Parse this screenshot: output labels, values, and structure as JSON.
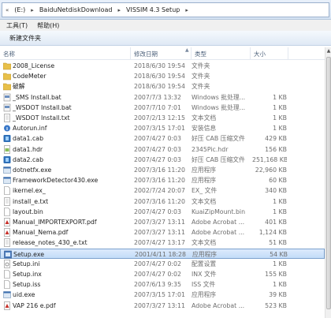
{
  "address": {
    "crumbs": [
      "(E:)",
      "BaiduNetdiskDownload",
      "VISSIM 4.3 Setup"
    ]
  },
  "menu": {
    "items": [
      "工具(T)",
      "帮助(H)"
    ]
  },
  "toolbar": {
    "new_folder": "新建文件夹"
  },
  "columns": {
    "name": "名称",
    "date": "修改日期",
    "type": "类型",
    "size": "大小"
  },
  "files": [
    {
      "name": "2008_License",
      "date": "2018/6/30 19:54",
      "type": "文件夹",
      "size": "",
      "icon": "folder-icon"
    },
    {
      "name": "CodeMeter",
      "date": "2018/6/30 19:54",
      "type": "文件夹",
      "size": "",
      "icon": "folder-icon"
    },
    {
      "name": "破解",
      "date": "2018/6/30 19:54",
      "type": "文件夹",
      "size": "",
      "icon": "folder-icon"
    },
    {
      "name": "_SMS Install.bat",
      "date": "2007/7/3 13:32",
      "type": "Windows 批处理...",
      "size": "1 KB",
      "icon": "bat-icon"
    },
    {
      "name": "_WSDOT Install.bat",
      "date": "2007/7/10 7:01",
      "type": "Windows 批处理...",
      "size": "1 KB",
      "icon": "bat-icon"
    },
    {
      "name": "_WSDOT Install.txt",
      "date": "2007/2/13 12:15",
      "type": "文本文档",
      "size": "1 KB",
      "icon": "txt-icon"
    },
    {
      "name": "Autorun.inf",
      "date": "2007/3/15 17:01",
      "type": "安装信息",
      "size": "1 KB",
      "icon": "inf-icon"
    },
    {
      "name": "data1.cab",
      "date": "2007/4/27 0:03",
      "type": "好压 CAB 压缩文件",
      "size": "429 KB",
      "icon": "cab-icon"
    },
    {
      "name": "data1.hdr",
      "date": "2007/4/27 0:03",
      "type": "2345Pic.hdr",
      "size": "156 KB",
      "icon": "hdr-icon"
    },
    {
      "name": "data2.cab",
      "date": "2007/4/27 0:03",
      "type": "好压 CAB 压缩文件",
      "size": "251,168 KB",
      "icon": "cab-icon"
    },
    {
      "name": "dotnetfx.exe",
      "date": "2007/3/16 11:20",
      "type": "应用程序",
      "size": "22,960 KB",
      "icon": "exe-icon"
    },
    {
      "name": "FrameworkDetector430.exe",
      "date": "2007/3/16 11:20",
      "type": "应用程序",
      "size": "60 KB",
      "icon": "exe-icon"
    },
    {
      "name": "ikernel.ex_",
      "date": "2002/7/24 20:07",
      "type": "EX_ 文件",
      "size": "340 KB",
      "icon": "file-icon"
    },
    {
      "name": "install_e.txt",
      "date": "2007/3/16 11:20",
      "type": "文本文档",
      "size": "1 KB",
      "icon": "txt-icon"
    },
    {
      "name": "layout.bin",
      "date": "2007/4/27 0:03",
      "type": "KuaiZipMount.bin",
      "size": "1 KB",
      "icon": "file-icon"
    },
    {
      "name": "Manual_IMPORTEXPORT.pdf",
      "date": "2007/3/27 13:11",
      "type": "Adobe Acrobat ...",
      "size": "401 KB",
      "icon": "pdf-icon"
    },
    {
      "name": "Manual_Nema.pdf",
      "date": "2007/3/27 13:11",
      "type": "Adobe Acrobat ...",
      "size": "1,124 KB",
      "icon": "pdf-icon"
    },
    {
      "name": "release_notes_430_e.txt",
      "date": "2007/4/27 13:17",
      "type": "文本文档",
      "size": "51 KB",
      "icon": "txt-icon"
    },
    {
      "name": "Setup.exe",
      "date": "2001/4/11 18:28",
      "type": "应用程序",
      "size": "54 KB",
      "icon": "setup-icon",
      "selected": true
    },
    {
      "name": "Setup.ini",
      "date": "2007/4/27 0:02",
      "type": "配置设置",
      "size": "1 KB",
      "icon": "ini-icon"
    },
    {
      "name": "Setup.inx",
      "date": "2007/4/27 0:02",
      "type": "INX 文件",
      "size": "155 KB",
      "icon": "file-icon"
    },
    {
      "name": "Setup.iss",
      "date": "2007/6/13 9:35",
      "type": "ISS 文件",
      "size": "1 KB",
      "icon": "file-icon"
    },
    {
      "name": "uid.exe",
      "date": "2007/3/15 17:01",
      "type": "应用程序",
      "size": "39 KB",
      "icon": "exe-icon"
    },
    {
      "name": "VAP 216 e.pdf",
      "date": "2007/3/27 13:11",
      "type": "Adobe Acrobat ...",
      "size": "523 KB",
      "icon": "pdf-icon"
    }
  ],
  "colors": {
    "folder": "#e8c04a",
    "selection": "#cde2fb",
    "pdf": "#c8302a"
  }
}
